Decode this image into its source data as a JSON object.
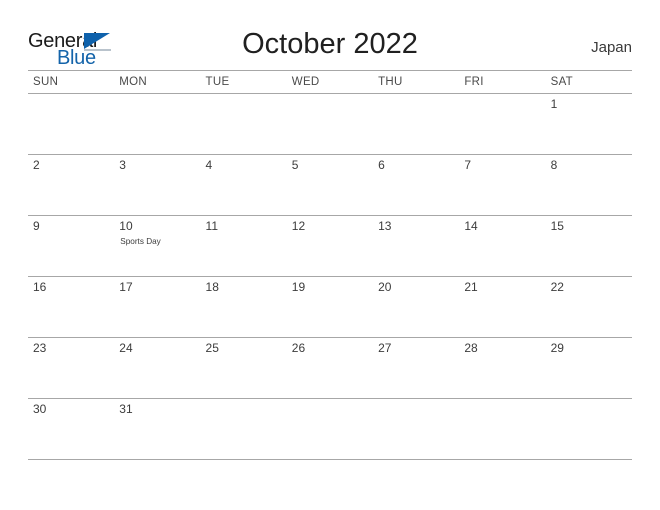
{
  "header": {
    "logo": {
      "word_top": "General",
      "word_bottom": "Blue",
      "accent_color": "#1464aa"
    },
    "title": "October 2022",
    "country": "Japan"
  },
  "calendar": {
    "day_headers": [
      "SUN",
      "MON",
      "TUE",
      "WED",
      "THU",
      "FRI",
      "SAT"
    ],
    "weeks": [
      [
        {
          "day": "",
          "event": ""
        },
        {
          "day": "",
          "event": ""
        },
        {
          "day": "",
          "event": ""
        },
        {
          "day": "",
          "event": ""
        },
        {
          "day": "",
          "event": ""
        },
        {
          "day": "",
          "event": ""
        },
        {
          "day": "1",
          "event": ""
        }
      ],
      [
        {
          "day": "2",
          "event": ""
        },
        {
          "day": "3",
          "event": ""
        },
        {
          "day": "4",
          "event": ""
        },
        {
          "day": "5",
          "event": ""
        },
        {
          "day": "6",
          "event": ""
        },
        {
          "day": "7",
          "event": ""
        },
        {
          "day": "8",
          "event": ""
        }
      ],
      [
        {
          "day": "9",
          "event": ""
        },
        {
          "day": "10",
          "event": "Sports Day"
        },
        {
          "day": "11",
          "event": ""
        },
        {
          "day": "12",
          "event": ""
        },
        {
          "day": "13",
          "event": ""
        },
        {
          "day": "14",
          "event": ""
        },
        {
          "day": "15",
          "event": ""
        }
      ],
      [
        {
          "day": "16",
          "event": ""
        },
        {
          "day": "17",
          "event": ""
        },
        {
          "day": "18",
          "event": ""
        },
        {
          "day": "19",
          "event": ""
        },
        {
          "day": "20",
          "event": ""
        },
        {
          "day": "21",
          "event": ""
        },
        {
          "day": "22",
          "event": ""
        }
      ],
      [
        {
          "day": "23",
          "event": ""
        },
        {
          "day": "24",
          "event": ""
        },
        {
          "day": "25",
          "event": ""
        },
        {
          "day": "26",
          "event": ""
        },
        {
          "day": "27",
          "event": ""
        },
        {
          "day": "28",
          "event": ""
        },
        {
          "day": "29",
          "event": ""
        }
      ],
      [
        {
          "day": "30",
          "event": ""
        },
        {
          "day": "31",
          "event": ""
        },
        {
          "day": "",
          "event": ""
        },
        {
          "day": "",
          "event": ""
        },
        {
          "day": "",
          "event": ""
        },
        {
          "day": "",
          "event": ""
        },
        {
          "day": "",
          "event": ""
        }
      ]
    ]
  }
}
